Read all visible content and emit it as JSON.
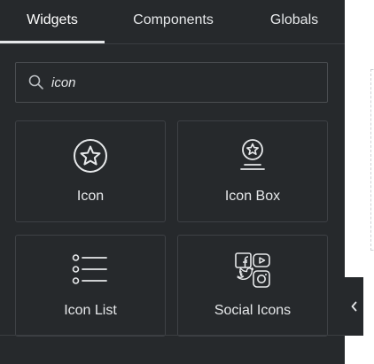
{
  "tabs": [
    {
      "label": "Widgets",
      "active": true
    },
    {
      "label": "Components",
      "active": false
    },
    {
      "label": "Globals",
      "active": false
    }
  ],
  "search": {
    "value": "icon",
    "icon": "search-icon"
  },
  "widgets": [
    {
      "label": "Icon",
      "icon": "star-circle-icon"
    },
    {
      "label": "Icon Box",
      "icon": "icon-box-icon"
    },
    {
      "label": "Icon List",
      "icon": "list-icon"
    },
    {
      "label": "Social Icons",
      "icon": "social-icons-icon"
    }
  ],
  "colors": {
    "panel_bg": "#26292c",
    "text": "#e6e8ea",
    "border": "#3e4145"
  }
}
